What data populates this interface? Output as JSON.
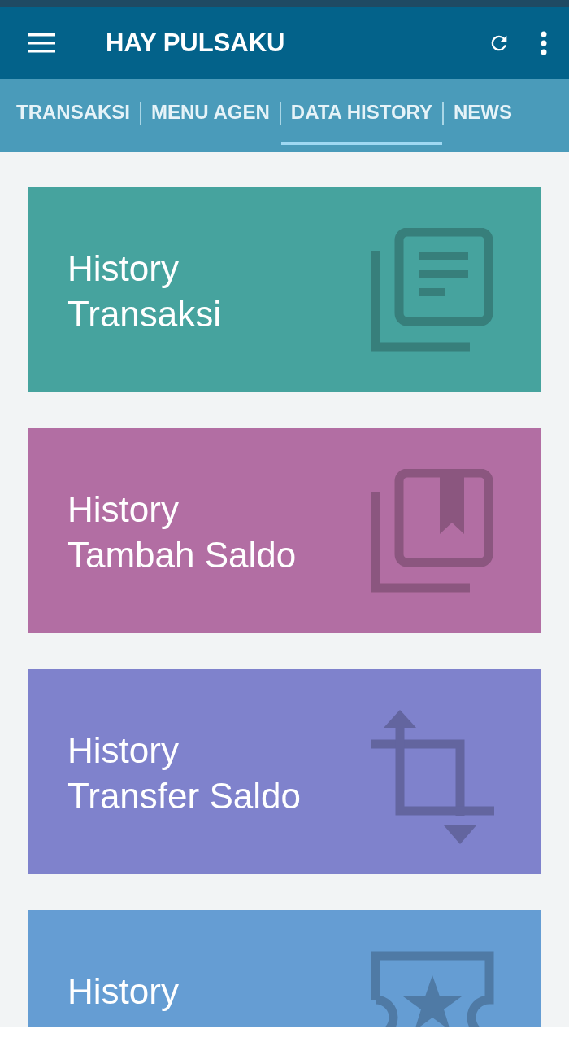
{
  "app_bar": {
    "title": "HAY PULSAKU"
  },
  "tabs": [
    {
      "label": "TRANSAKSI",
      "selected": false
    },
    {
      "label": "MENU AGEN",
      "selected": false
    },
    {
      "label": "DATA HISTORY",
      "selected": true
    },
    {
      "label": "NEWS",
      "selected": false
    }
  ],
  "cards": [
    {
      "lines": [
        "History",
        "Transaksi"
      ],
      "kind": "article",
      "color": "#46a39e"
    },
    {
      "lines": [
        "History",
        "Tambah Saldo"
      ],
      "kind": "bookmark",
      "color": "#b26ea3"
    },
    {
      "lines": [
        "History",
        "Transfer Saldo"
      ],
      "kind": "transfer",
      "color": "#7f82cc"
    },
    {
      "lines": [
        "History"
      ],
      "kind": "ticket",
      "color": "#659dd3"
    }
  ]
}
